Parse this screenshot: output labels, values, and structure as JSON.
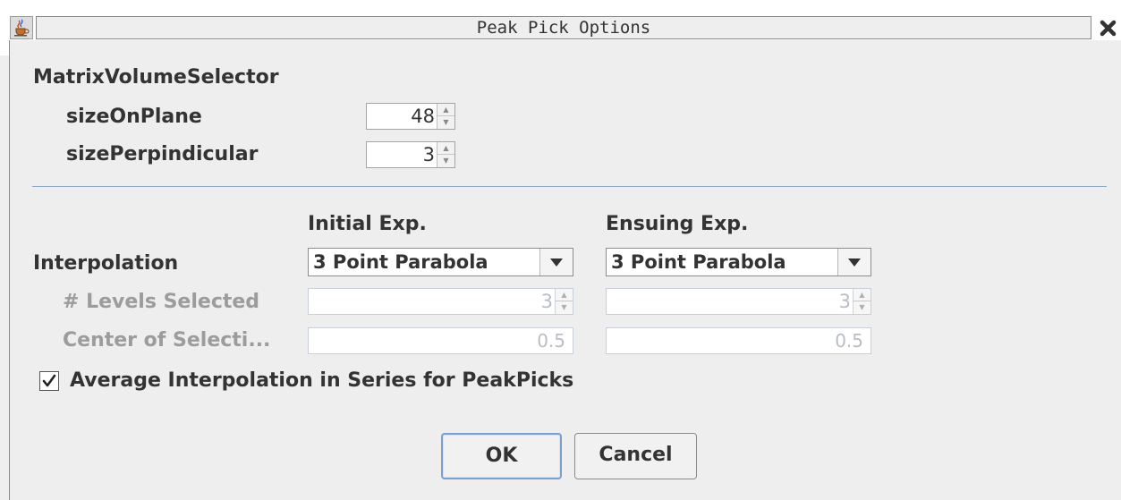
{
  "window": {
    "title": "Peak Pick Options",
    "app_icon": "java-coffee-cup-icon",
    "close_icon": "close-x-icon"
  },
  "matrix": {
    "heading": "MatrixVolumeSelector",
    "size_on_plane": {
      "label": "sizeOnPlane",
      "value": "48"
    },
    "size_perp": {
      "label": "sizePerpindicular",
      "value": "3"
    }
  },
  "interp": {
    "col_initial": "Initial Exp.",
    "col_ensuing": "Ensuing Exp.",
    "row_label": "Interpolation",
    "initial_value": "3 Point Parabola",
    "ensuing_value": "3 Point Parabola",
    "levels_label": "# Levels Selected",
    "levels_initial": "3",
    "levels_ensuing": "3",
    "center_label": "Center of Selecti...",
    "center_initial": "0.5",
    "center_ensuing": "0.5"
  },
  "average": {
    "label": "Average Interpolation in Series for PeakPicks",
    "checked": true
  },
  "buttons": {
    "ok": "OK",
    "cancel": "Cancel"
  },
  "colors": {
    "background": "#eeeeee",
    "separator": "#8fa6c6",
    "default_button_border": "#7aa0cf",
    "disabled_text": "#9c9c9c"
  }
}
